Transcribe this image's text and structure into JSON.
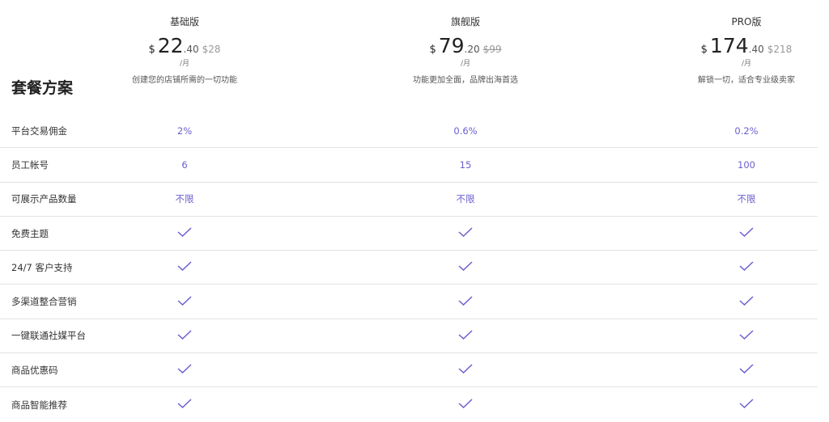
{
  "title": "套餐方案",
  "plans": [
    {
      "name": "基础版",
      "currency": "$",
      "price_int": "22",
      "price_dec": ".40",
      "original": "$28",
      "original_struck": false,
      "period": "/月",
      "desc": "创建您的店铺所需的一切功能"
    },
    {
      "name": "旗舰版",
      "currency": "$",
      "price_int": "79",
      "price_dec": ".20",
      "original": "$99",
      "original_struck": true,
      "period": "/月",
      "desc": "功能更加全面，品牌出海首选"
    },
    {
      "name": "PRO版",
      "currency": "$",
      "price_int": "174",
      "price_dec": ".40",
      "original": "$218",
      "original_struck": false,
      "period": "/月",
      "desc": "解锁一切，适合专业级卖家"
    }
  ],
  "accent": "#6a5fd0",
  "features": [
    {
      "label": "平台交易佣金",
      "values": [
        "2%",
        "0.6%",
        "0.2%"
      ]
    },
    {
      "label": "员工帐号",
      "values": [
        "6",
        "15",
        "100"
      ]
    },
    {
      "label": "可展示产品数量",
      "values": [
        "不限",
        "不限",
        "不限"
      ]
    },
    {
      "label": "免费主题",
      "values": [
        "check-icon",
        "check-icon",
        "check-icon"
      ]
    },
    {
      "label": "24/7 客户支持",
      "values": [
        "check-icon",
        "check-icon",
        "check-icon"
      ]
    },
    {
      "label": "多渠道整合营销",
      "values": [
        "check-icon",
        "check-icon",
        "check-icon"
      ]
    },
    {
      "label": "一键联通社媒平台",
      "values": [
        "check-icon",
        "check-icon",
        "check-icon"
      ]
    },
    {
      "label": "商品优惠码",
      "values": [
        "check-icon",
        "check-icon",
        "check-icon"
      ]
    },
    {
      "label": "商品智能推荐",
      "values": [
        "check-icon",
        "check-icon",
        "check-icon"
      ]
    }
  ]
}
